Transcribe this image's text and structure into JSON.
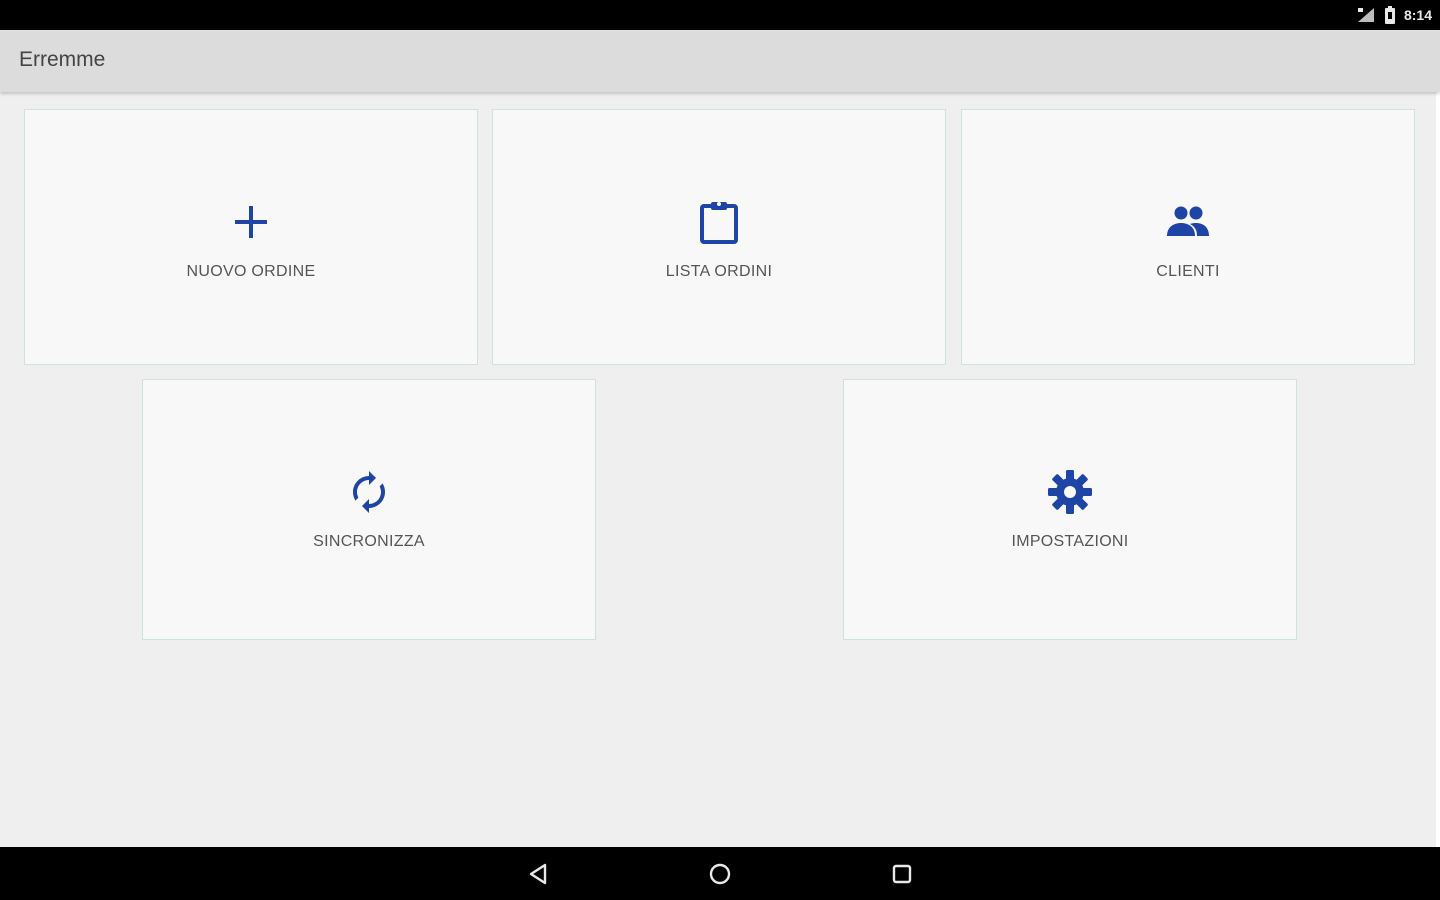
{
  "status_bar": {
    "time": "8:14"
  },
  "app_bar": {
    "title": "Erremme"
  },
  "tiles": [
    {
      "label": "NUOVO ORDINE",
      "icon": "plus-icon"
    },
    {
      "label": "LISTA ORDINI",
      "icon": "clipboard-icon"
    },
    {
      "label": "CLIENTI",
      "icon": "people-icon"
    },
    {
      "label": "SINCRONIZZA",
      "icon": "sync-icon"
    },
    {
      "label": "IMPOSTAZIONI",
      "icon": "gear-icon"
    }
  ],
  "nav_bar": {
    "buttons": [
      "back-icon",
      "home-icon",
      "recents-icon"
    ]
  },
  "colors": {
    "accent": "#1e44a6",
    "tile_background": "#f8f8f8",
    "tile_border": "#cfe3de",
    "app_bar": "#dcdcdc",
    "content_background": "#efefef"
  }
}
